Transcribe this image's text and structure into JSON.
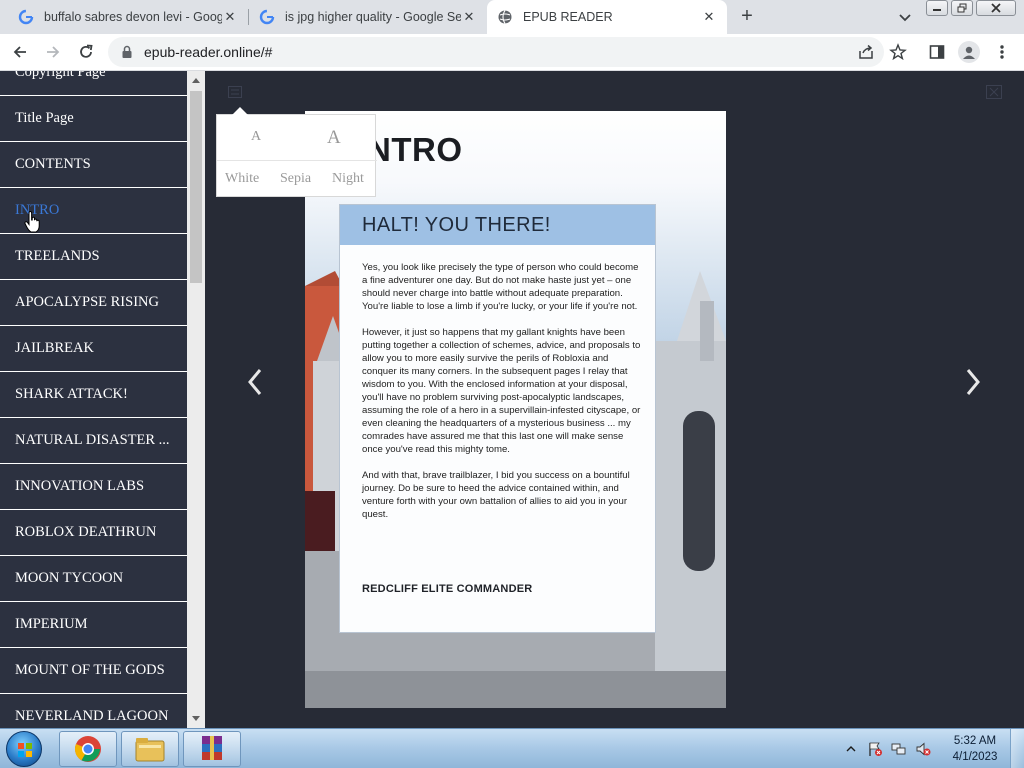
{
  "browser": {
    "tabs": [
      {
        "title": "buffalo sabres devon levi - Goog",
        "icon": "google-icon"
      },
      {
        "title": "is jpg higher quality - Google Se",
        "icon": "google-icon"
      },
      {
        "title": "EPUB READER",
        "icon": "globe-icon"
      }
    ],
    "close_glyph": "✕",
    "new_tab_glyph": "+",
    "url": "epub-reader.online/#"
  },
  "reader": {
    "toc": [
      "Copyright Page",
      "Title Page",
      "CONTENTS",
      "INTRO",
      "TREELANDS",
      "APOCALYPSE RISING",
      "JAILBREAK",
      "SHARK ATTACK!",
      "NATURAL DISASTER ...",
      "INNOVATION LABS",
      "ROBLOX DEATHRUN",
      "MOON TYCOON",
      "IMPERIUM",
      "MOUNT OF THE GODS",
      "NEVERLAND LAGOON"
    ],
    "active_toc_index": 3,
    "theme_popup": {
      "size_small": "A",
      "size_large": "A",
      "themes": [
        "White",
        "Sepia",
        "Night"
      ]
    },
    "page": {
      "heading": "NTRO",
      "card_title": "HALT! YOU THERE!",
      "paragraphs": [
        "Yes, you look like precisely the type of person who could become a fine adventurer one day. But do not make haste just yet – one should never charge into battle without adequate preparation. You're liable to lose a limb if you're lucky, or your life if you're not.",
        "However, it just so happens that my gallant knights have been putting together a collection of schemes, advice, and proposals to allow you to more easily survive the perils of Robloxia and conquer its many corners. In the subsequent pages I relay that wisdom to you. With the enclosed information at your disposal, you'll have no problem surviving post-apocalyptic landscapes, assuming the role of a hero in a supervillain-infested cityscape, or even cleaning the headquarters of a mysterious business ... my comrades have assured me that this last one will make sense once you've read this mighty tome.",
        "And with that, brave trailblazer, I bid you success on a bountiful journey. Do be sure to heed the advice contained within, and venture forth with your own battalion of allies to aid you in your quest."
      ],
      "signature": "REDCLIFF ELITE COMMANDER"
    }
  },
  "taskbar": {
    "time": "5:32 AM",
    "date": "4/1/2023"
  },
  "colors": {
    "sidebar_bg": "#2c3140",
    "reader_bg": "#272b36",
    "toc_active": "#3a78d6",
    "card_header": "#9ec0e4"
  }
}
